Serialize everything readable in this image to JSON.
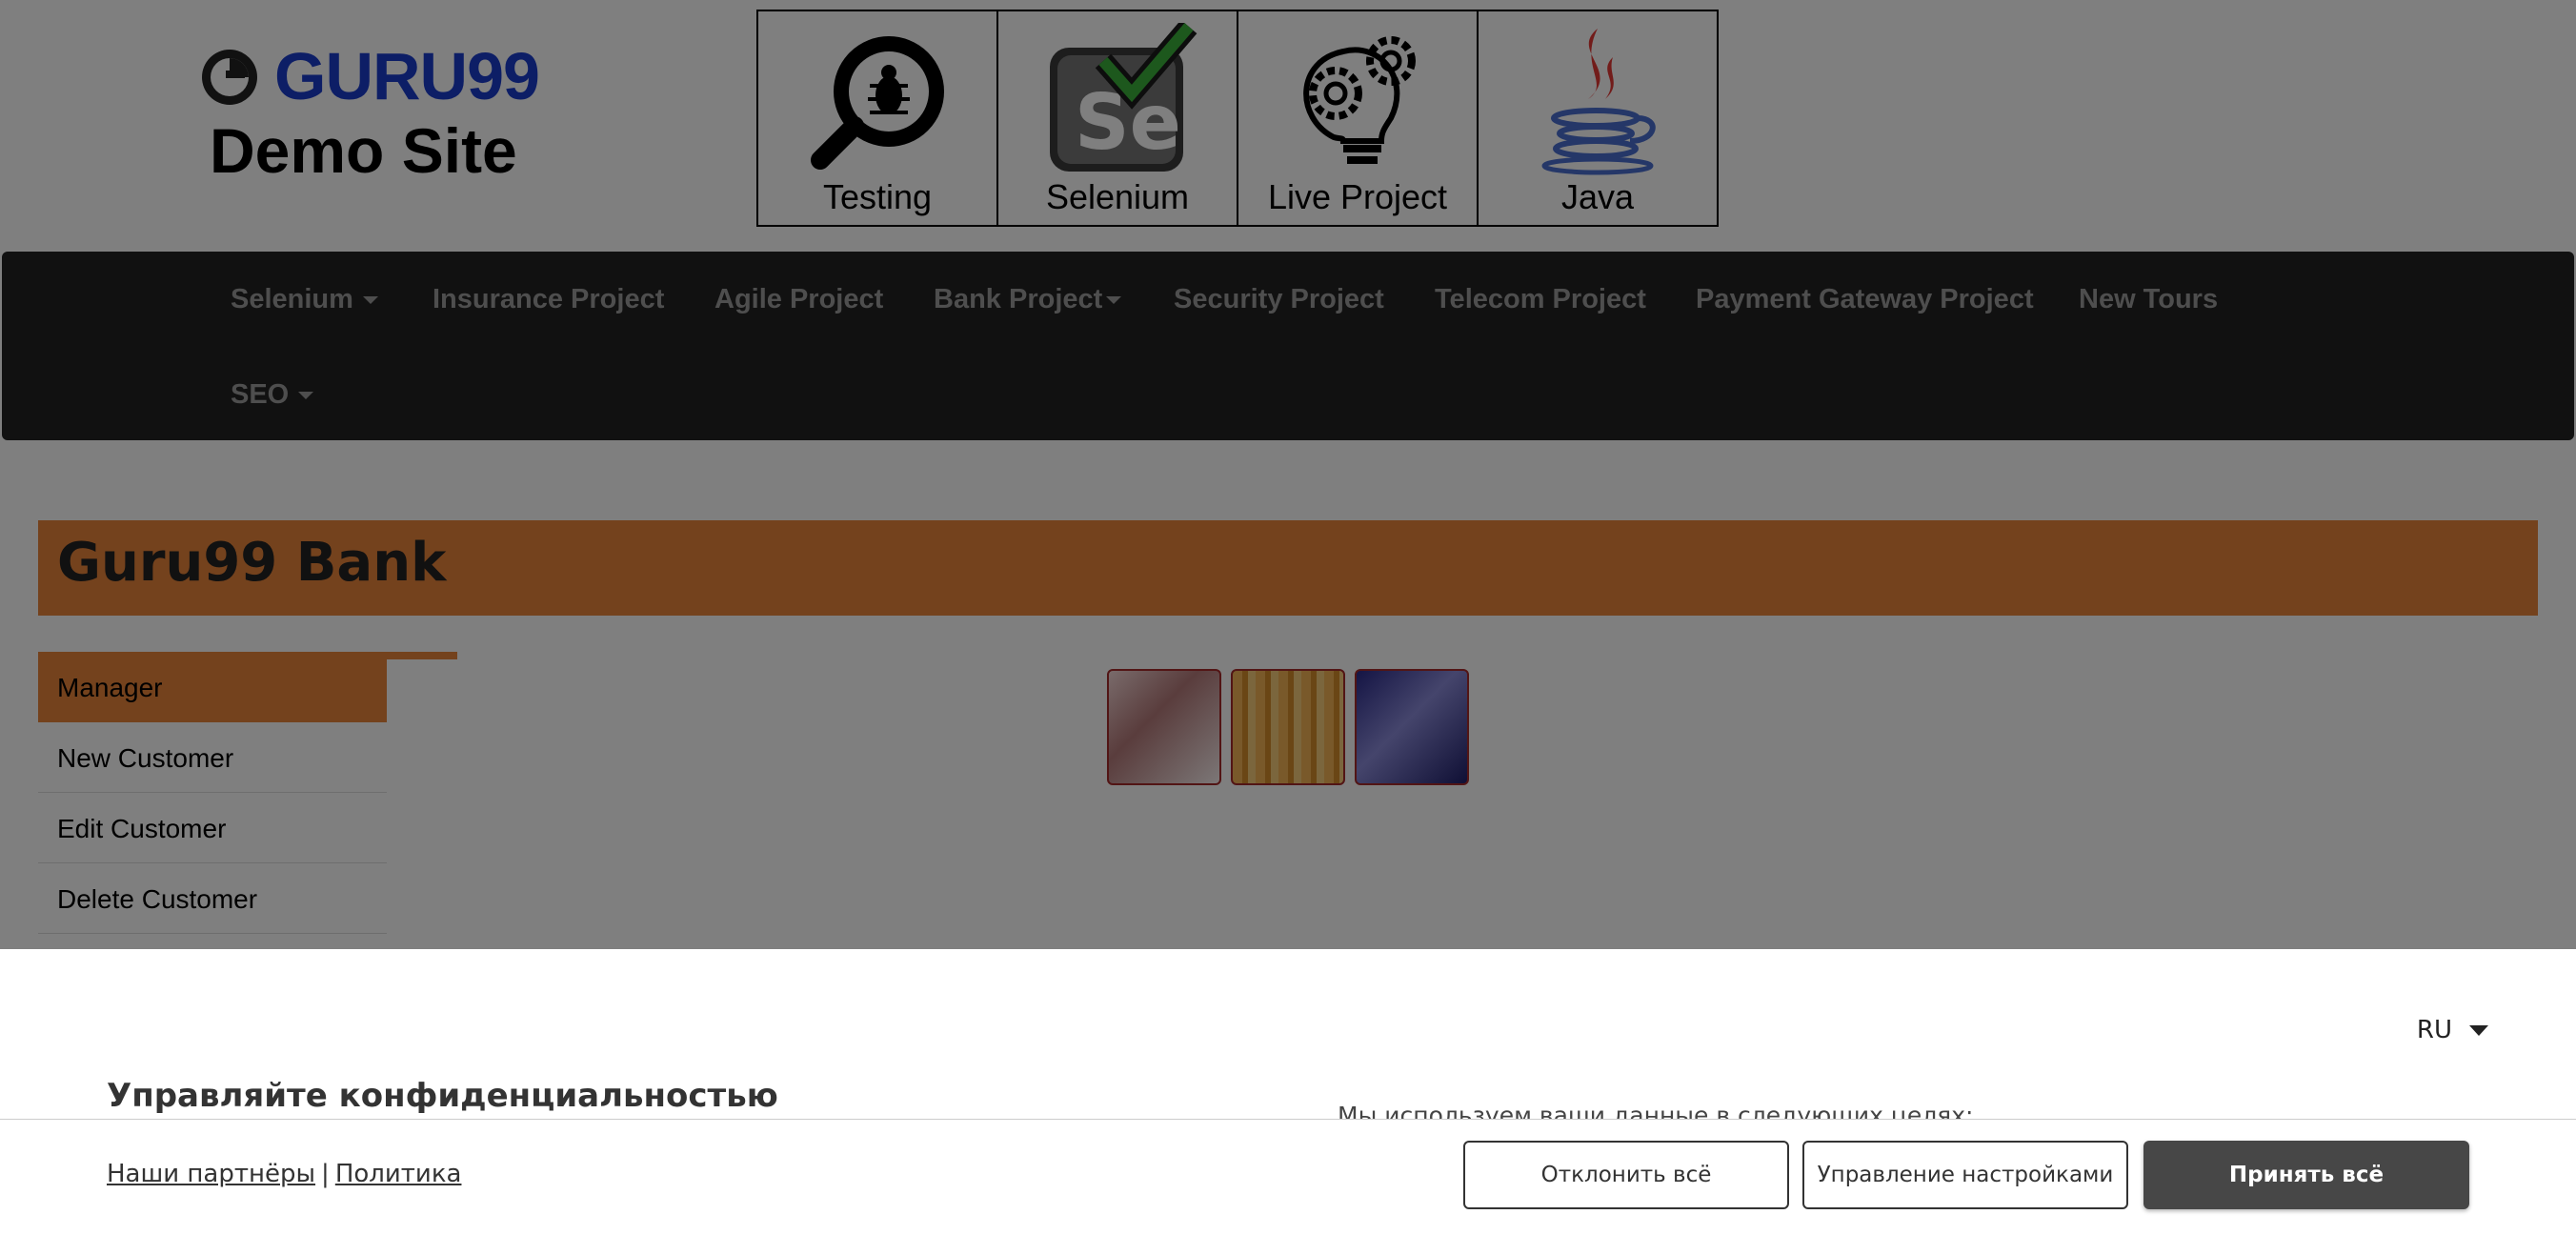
{
  "header": {
    "logo_brand": "GURU99",
    "logo_subtitle": "Demo Site",
    "tiles": [
      {
        "label": "Testing",
        "icon": "magnifier-bug-icon"
      },
      {
        "label": "Selenium",
        "icon": "selenium-check-icon"
      },
      {
        "label": "Live Project",
        "icon": "lightbulb-gears-icon"
      },
      {
        "label": "Java",
        "icon": "java-coffee-icon"
      }
    ]
  },
  "navbar": {
    "items": [
      {
        "label": "Selenium",
        "dropdown": true
      },
      {
        "label": "Insurance Project"
      },
      {
        "label": "Agile Project"
      },
      {
        "label": "Bank Project",
        "dropdown": true
      },
      {
        "label": "Security Project"
      },
      {
        "label": "Telecom Project"
      },
      {
        "label": "Payment Gateway Project"
      },
      {
        "label": "New Tours"
      },
      {
        "label": "SEO",
        "dropdown": true
      }
    ]
  },
  "bank": {
    "title": "Guru99 Bank",
    "menu": [
      {
        "label": "Manager",
        "active": true
      },
      {
        "label": "New Customer"
      },
      {
        "label": "Edit Customer"
      },
      {
        "label": "Delete Customer"
      }
    ]
  },
  "consent": {
    "language": "RU",
    "title": "Управляйте конфиденциальностью",
    "purposes_text": "Мы используем ваши данные в следующих целях:",
    "partners_link": "Наши партнёры",
    "separator": "|",
    "policy_link": "Политика",
    "reject_label": "Отклонить всё",
    "manage_label": "Управление настройками",
    "accept_label": "Принять всё"
  },
  "colors": {
    "accent": "#e8843b",
    "navbar_bg": "#222222",
    "nav_text": "#9d9d9d",
    "brand_blue": "#1b3ccc",
    "primary_button": "#474747"
  }
}
